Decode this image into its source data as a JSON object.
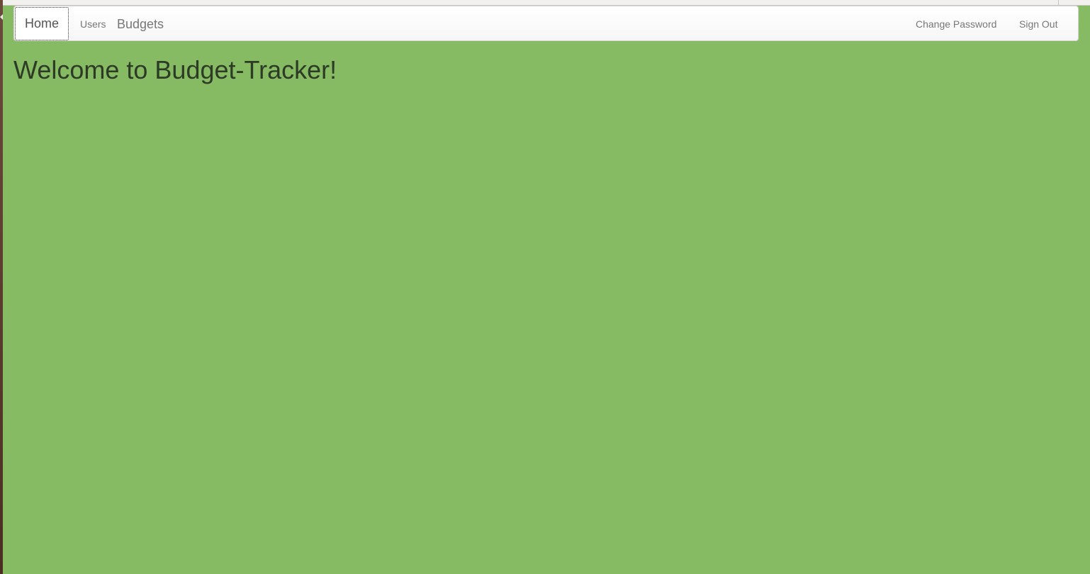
{
  "navbar": {
    "home_label": "Home",
    "users_label": "Users",
    "budgets_label": "Budgets",
    "change_password_label": "Change Password",
    "sign_out_label": "Sign Out"
  },
  "main": {
    "heading": "Welcome to Budget-Tracker!"
  },
  "colors": {
    "page_background": "#86bb64",
    "navbar_background": "#ffffff",
    "nav_text": "#777777",
    "heading_text": "#2d3a26"
  }
}
